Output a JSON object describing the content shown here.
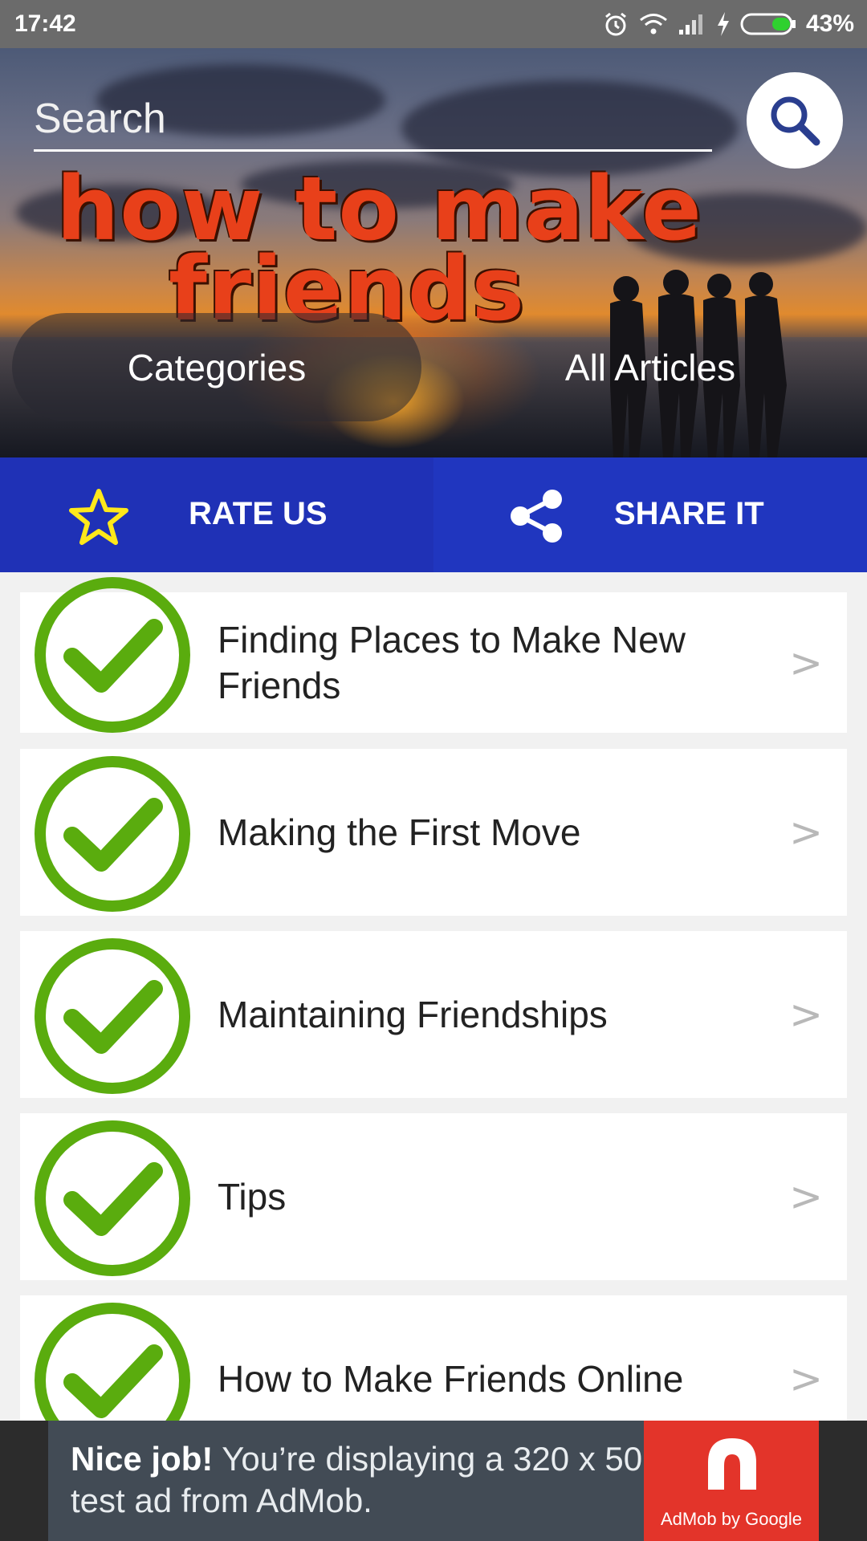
{
  "status_bar": {
    "time": "17:42",
    "battery": "43%"
  },
  "header": {
    "search_placeholder": "Search",
    "logo_line1": "how to make",
    "logo_line2": "friends",
    "categories_label": "Categories",
    "all_articles_label": "All Articles"
  },
  "action_bar": {
    "rate_label": "RATE US",
    "share_label": "SHARE IT"
  },
  "list": {
    "items": [
      {
        "title": "Finding Places to Make New Friends",
        "icon": "check-circle-icon",
        "chevron": ">"
      },
      {
        "title": "Making the First Move",
        "icon": "check-circle-icon",
        "chevron": ">"
      },
      {
        "title": "Maintaining Friendships",
        "icon": "check-circle-icon",
        "chevron": ">"
      },
      {
        "title": "Tips",
        "icon": "check-circle-icon",
        "chevron": ">"
      },
      {
        "title": "How to Make Friends Online",
        "icon": "check-circle-icon",
        "chevron": ">"
      }
    ]
  },
  "ad": {
    "bold": "Nice job!",
    "text": " You’re displaying a 320 x 50 test ad from AdMob.",
    "brand": "AdMob by Google"
  },
  "colors": {
    "action_bar": "#1e33b5",
    "check_green": "#5aac0e",
    "ad_red": "#e3342a"
  }
}
